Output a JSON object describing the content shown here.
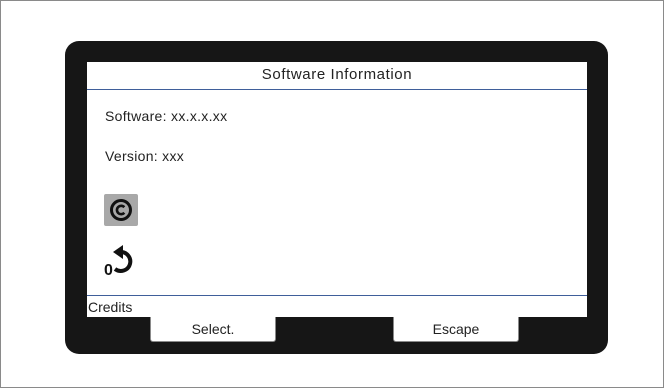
{
  "screen": {
    "title": "Software Information",
    "software_line": "Software: xx.x.x.xx",
    "version_line": "Version: xxx",
    "credits_label": "Credits"
  },
  "icons": {
    "copyright": "copyright-icon",
    "back": "back-arrow-zero-icon",
    "back_digit": "0"
  },
  "softkeys": {
    "select_label": "Select.",
    "escape_label": "Escape"
  },
  "colors": {
    "bezel": "#161616",
    "divider": "#3f5e9a",
    "icon_tile": "#a8a8a8"
  }
}
